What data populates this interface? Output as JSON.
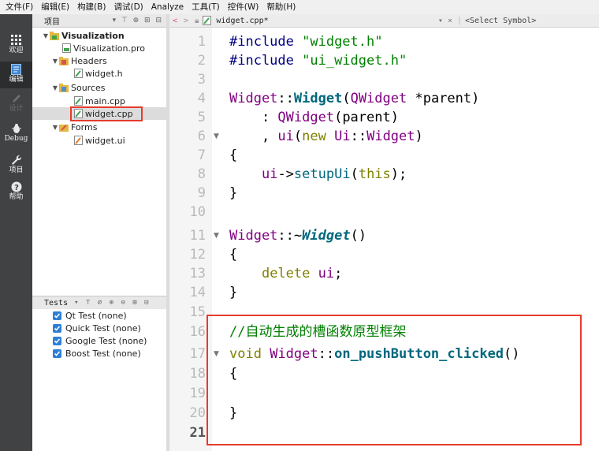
{
  "menubar": [
    {
      "label": "文件(F)"
    },
    {
      "label": "编辑(E)"
    },
    {
      "label": "构建(B)"
    },
    {
      "label": "调试(D)"
    },
    {
      "label": "Analyze"
    },
    {
      "label": "工具(T)"
    },
    {
      "label": "控件(W)"
    },
    {
      "label": "帮助(H)"
    }
  ],
  "modes": [
    {
      "label": "欢迎",
      "icon": "grid-icon"
    },
    {
      "label": "编辑",
      "icon": "document-icon"
    },
    {
      "label": "设计",
      "icon": "pencil-icon"
    },
    {
      "label": "Debug",
      "icon": "bug-icon"
    },
    {
      "label": "项目",
      "icon": "wrench-icon"
    },
    {
      "label": "帮助",
      "icon": "help-icon"
    }
  ],
  "project_panel": {
    "title": "项目",
    "tree": [
      {
        "label": "Visualization",
        "bold": true
      },
      {
        "label": "Visualization.pro"
      },
      {
        "label": "Headers"
      },
      {
        "label": "widget.h"
      },
      {
        "label": "Sources"
      },
      {
        "label": "main.cpp"
      },
      {
        "label": "widget.cpp"
      },
      {
        "label": "Forms"
      },
      {
        "label": "widget.ui"
      }
    ]
  },
  "tests_panel": {
    "title": "Tests",
    "items": [
      {
        "label": "Qt Test (none)",
        "checked": true
      },
      {
        "label": "Quick Test (none)",
        "checked": true
      },
      {
        "label": "Google Test (none)",
        "checked": true
      },
      {
        "label": "Boost Test (none)",
        "checked": true
      }
    ]
  },
  "editor": {
    "filename": "widget.cpp*",
    "symbol": "<Select Symbol>",
    "current_line": 21,
    "line_numbers": [
      "1",
      "2",
      "3",
      "4",
      "5",
      "6",
      "7",
      "8",
      "9",
      "10",
      "11",
      "12",
      "13",
      "14",
      "15",
      "16",
      "17",
      "18",
      "19",
      "20",
      "21"
    ],
    "lines": {
      "l1_directive": "#include ",
      "l1_string": "\"widget.h\"",
      "l2_directive": "#include ",
      "l2_string": "\"ui_widget.h\"",
      "l4_class": "Widget",
      "l4_scope": "::",
      "l4_func": "Widget",
      "l4_open": "(",
      "l4_type": "QWidget",
      "l4_rest": " *parent)",
      "l5_colon": "    : ",
      "l5_base": "QWidget",
      "l5_rest": "(parent)",
      "l6_comma": "    , ",
      "l6_member": "ui",
      "l6_open": "(",
      "l6_new": "new",
      "l6_space": " ",
      "l6_ns": "Ui",
      "l6_scope": "::",
      "l6_cls": "Widget",
      "l6_close": ")",
      "l7": "{",
      "l8_indent": "    ",
      "l8_member": "ui",
      "l8_arrow": "->",
      "l8_call": "setupUi",
      "l8_open": "(",
      "l8_this": "this",
      "l8_close": ");",
      "l9": "}",
      "l11_class": "Widget",
      "l11_scope": "::~",
      "l11_func": "Widget",
      "l11_rest": "()",
      "l12": "{",
      "l13_indent": "    ",
      "l13_delete": "delete",
      "l13_space": " ",
      "l13_member": "ui",
      "l13_semi": ";",
      "l14": "}",
      "l16_comment": "//自动生成的槽函数原型框架",
      "l17_void": "void",
      "l17_space": " ",
      "l17_class": "Widget",
      "l17_scope": "::",
      "l17_func": "on_pushButton_clicked",
      "l17_rest": "()",
      "l18": "{",
      "l20": "}"
    }
  },
  "colors": {
    "mode_sidebar": "#404244",
    "highlight_box": "#e53b2c",
    "checkbox": "#2d7fd6"
  }
}
